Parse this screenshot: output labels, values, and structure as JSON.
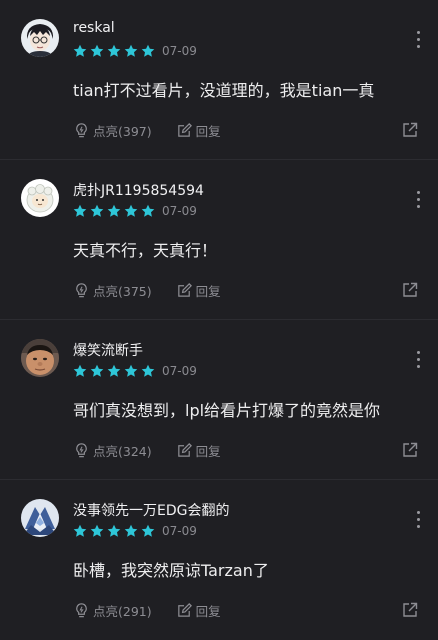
{
  "colors": {
    "background": "#1f1f23",
    "star": "#2ec6d8",
    "secondary_text": "#8d8d93",
    "divider": "#2c2c31"
  },
  "rating_max": 5,
  "comments": [
    {
      "username": "reskal",
      "avatar": "anime-boy-glasses",
      "rating": 5,
      "date": "07-09",
      "content": "tian打不过看片，没道理的，我是tian一真",
      "like_label": "点亮(397)",
      "reply_label": "回复"
    },
    {
      "username": "虎扑JR1195854594",
      "avatar": "cartoon-sheep",
      "rating": 5,
      "date": "07-09",
      "content": "天真不行，天真行！",
      "like_label": "点亮(375)",
      "reply_label": "回复"
    },
    {
      "username": "爆笑流断手",
      "avatar": "man-face-photo",
      "rating": 5,
      "date": "07-09",
      "content": "哥们真没想到，lpl给看片打爆了的竟然是你",
      "like_label": "点亮(324)",
      "reply_label": "回复"
    },
    {
      "username": "没事领先一万EDG会翻的",
      "avatar": "mecha-blue",
      "rating": 5,
      "date": "07-09",
      "content": "卧槽，我突然原谅Tarzan了",
      "like_label": "点亮(291)",
      "reply_label": "回复"
    }
  ]
}
